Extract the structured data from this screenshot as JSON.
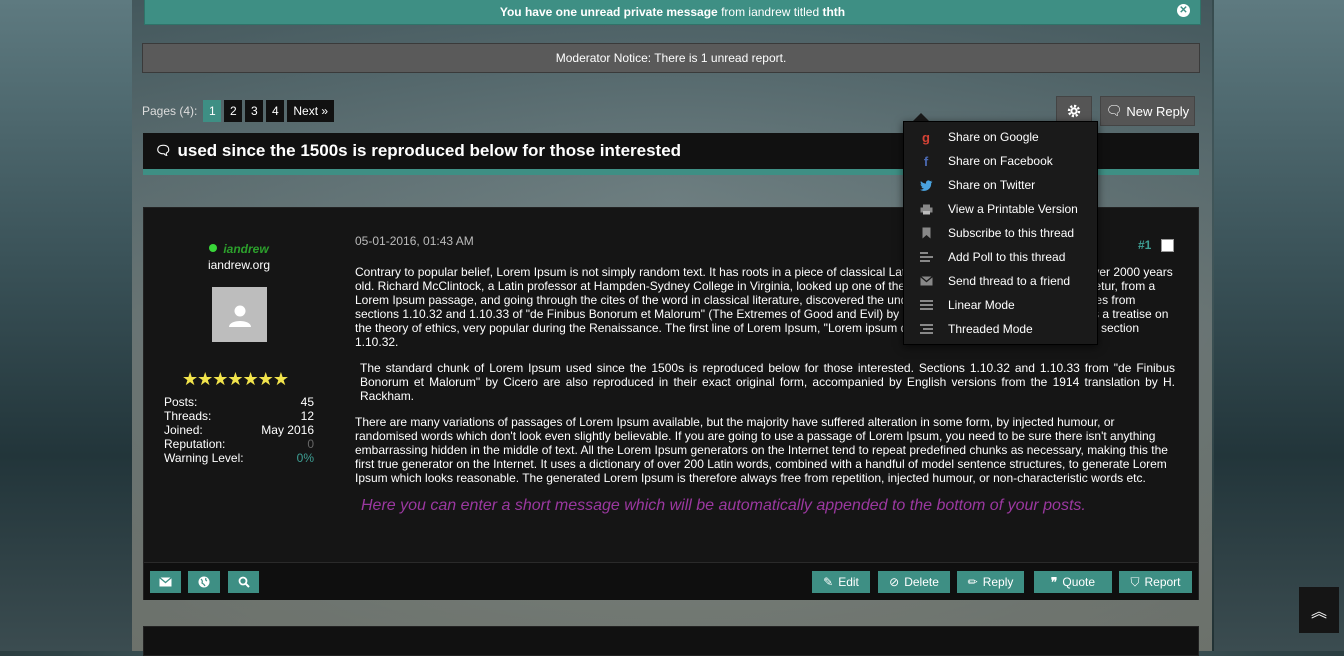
{
  "notifications": {
    "pm_prefix": "You have one unread private message",
    "pm_from_label": "from",
    "pm_from": "iandrew",
    "pm_titled_label": "titled",
    "pm_title": "thth",
    "moderator_notice": "Moderator Notice: There is 1 unread report."
  },
  "pagination": {
    "label": "Pages (4):",
    "pages": [
      "1",
      "2",
      "3",
      "4"
    ],
    "current": "1",
    "next_label": "Next »"
  },
  "toolbar": {
    "new_reply_label": "New Reply"
  },
  "thread": {
    "title": "used since the 1500s is reproduced below for those interested"
  },
  "post": {
    "username": "iandrew",
    "user_title": "iandrew.org",
    "stars": "★★★★★★★",
    "stats": [
      {
        "label": "Posts:",
        "value": "45"
      },
      {
        "label": "Threads:",
        "value": "12"
      },
      {
        "label": "Joined:",
        "value": "May 2016"
      },
      {
        "label": "Reputation:",
        "value": "0"
      },
      {
        "label": "Warning Level:",
        "value": "0%"
      }
    ],
    "date": "05-01-2016, 01:43 AM",
    "number": "#1",
    "paragraph1": "Contrary to popular belief, Lorem Ipsum is not simply random text. It has roots in a piece of classical Latin literature from 45 BC, making it over 2000 years old. Richard McClintock, a Latin professor at Hampden-Sydney College in Virginia, looked up one of the more obscure Latin words, consectetur, from a Lorem Ipsum passage, and going through the cites of the word in classical literature, discovered the undoubtable source. Lorem Ipsum comes from sections 1.10.32 and 1.10.33 of \"de Finibus Bonorum et Malorum\" (The Extremes of Good and Evil) by Cicero, written in 45 BC. This book is a treatise on the theory of ethics, very popular during the Renaissance. The first line of Lorem Ipsum, \"Lorem ipsum dolor sit amet..\", comes from a line in section 1.10.32.",
    "quote": "The standard chunk of Lorem Ipsum used since the 1500s is reproduced below for those interested. Sections 1.10.32 and 1.10.33 from \"de Finibus Bonorum et Malorum\" by Cicero are also reproduced in their exact original form, accompanied by English versions from the 1914 translation by H. Rackham.",
    "paragraph2": "There are many variations of passages of Lorem Ipsum available, but the majority have suffered alteration in some form, by injected humour, or randomised words which don't look even slightly believable. If you are going to use a passage of Lorem Ipsum, you need to be sure there isn't anything embarrassing hidden in the middle of text. All the Lorem Ipsum generators on the Internet tend to repeat predefined chunks as necessary, making this the first true generator on the Internet. It uses a dictionary of over 200 Latin words, combined with a handful of model sentence structures, to generate Lorem Ipsum which looks reasonable. The generated Lorem Ipsum is therefore always free from repetition, injected humour, or non-characteristic words etc.",
    "signature": "Here you can enter a short message which will be automatically appended to the bottom of your posts.",
    "buttons": {
      "edit": "Edit",
      "delete": "Delete",
      "reply": "Reply",
      "quote": "Quote",
      "report": "Report"
    }
  },
  "thread_menu": [
    {
      "label": "Share on Google",
      "icon": "google-icon"
    },
    {
      "label": "Share on Facebook",
      "icon": "facebook-icon"
    },
    {
      "label": "Share on Twitter",
      "icon": "twitter-icon"
    },
    {
      "label": "View a Printable Version",
      "icon": "printer-icon"
    },
    {
      "label": "Subscribe to this thread",
      "icon": "bookmark-icon"
    },
    {
      "label": "Add Poll to this thread",
      "icon": "poll-icon"
    },
    {
      "label": "Send thread to a friend",
      "icon": "envelope-icon"
    },
    {
      "label": "Linear Mode",
      "icon": "linear-mode-icon"
    },
    {
      "label": "Threaded Mode",
      "icon": "threaded-mode-icon"
    }
  ],
  "colors": {
    "accent": "#3e8f84",
    "username": "#2ca02c",
    "signature": "#9b38a0",
    "stars": "#f2e44c"
  }
}
